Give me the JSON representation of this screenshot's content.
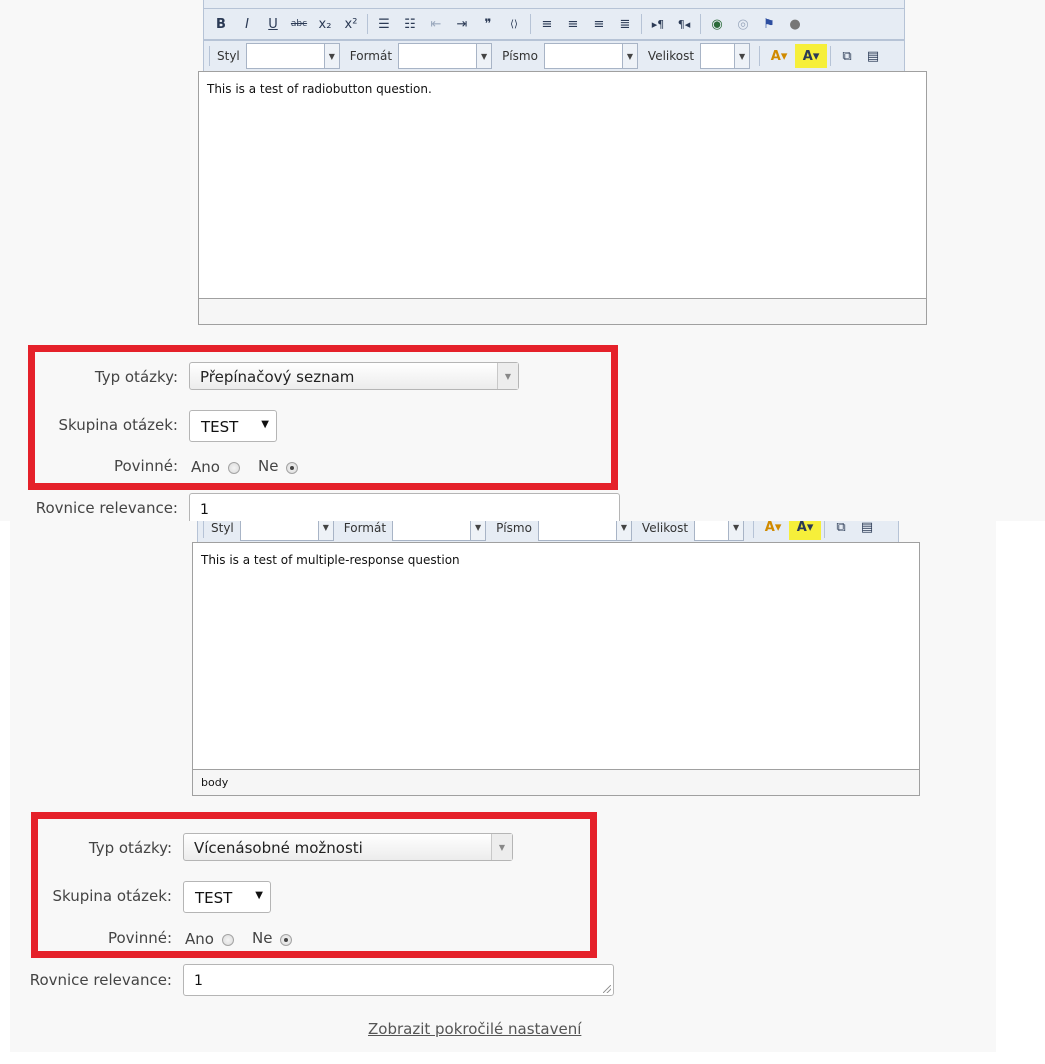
{
  "editor_toolbar": {
    "style_label": "Styl",
    "format_label": "Formát",
    "font_label": "Písmo",
    "size_label": "Velikost",
    "bold": "B",
    "italic": "I",
    "underline": "U",
    "strike": "abc",
    "subscript": "x₂",
    "superscript": "x²"
  },
  "question1": {
    "editor_text": "This is a test of radiobutton question.",
    "editor_status": "",
    "type_label": "Typ otázky:",
    "type_value": "Přepínačový seznam",
    "group_label": "Skupina otázek:",
    "group_value": "TEST",
    "mandatory_label": "Povinné:",
    "option_yes": "Ano",
    "option_no": "Ne",
    "relevance_label": "Rovnice relevance:",
    "relevance_value": "1"
  },
  "question2": {
    "editor_text": "This is a test of multiple-response question",
    "editor_status": "body",
    "type_label": "Typ otázky:",
    "type_value": "Vícenásobné možnosti",
    "group_label": "Skupina otázek:",
    "group_value": "TEST",
    "mandatory_label": "Povinné:",
    "option_yes": "Ano",
    "option_no": "Ne",
    "relevance_label": "Rovnice relevance:",
    "relevance_value": "1",
    "advanced_link": "Zobrazit pokročilé nastavení"
  },
  "mandatory_selected": "no",
  "colors": {
    "highlight": "#e5212a",
    "toolbar_bg": "#e6ecf4",
    "panel_bg": "#f8f8f8"
  }
}
